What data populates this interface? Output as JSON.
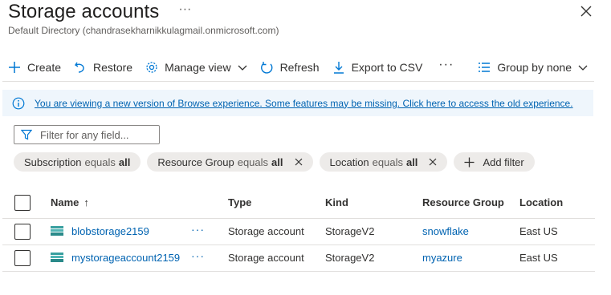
{
  "header": {
    "title": "Storage accounts",
    "more_label": "···",
    "subtitle": "Default Directory (chandrasekharnikkulagmail.onmicrosoft.com)",
    "close_icon": "close-icon"
  },
  "toolbar": {
    "create": "Create",
    "restore": "Restore",
    "manage_view": "Manage view",
    "refresh": "Refresh",
    "export_csv": "Export to CSV",
    "more": "···",
    "group_by": "Group by none"
  },
  "banner": {
    "text": "You are viewing a new version of Browse experience. Some features may be missing. Click here to access the old experience."
  },
  "filter": {
    "placeholder": "Filter for any field...",
    "value": ""
  },
  "pills": [
    {
      "field": "Subscription",
      "op": "equals",
      "value": "all",
      "removable": false
    },
    {
      "field": "Resource Group",
      "op": "equals",
      "value": "all",
      "removable": true
    },
    {
      "field": "Location",
      "op": "equals",
      "value": "all",
      "removable": true
    }
  ],
  "add_filter": "Add filter",
  "table": {
    "columns": {
      "name": "Name",
      "sort_indicator": "↑",
      "type": "Type",
      "kind": "Kind",
      "resource_group": "Resource Group",
      "location": "Location"
    },
    "rows": [
      {
        "name": "blobstorage2159",
        "more": "···",
        "type": "Storage account",
        "kind": "StorageV2",
        "resource_group": "snowflake",
        "location": "East US"
      },
      {
        "name": "mystorageaccount2159",
        "more": "···",
        "type": "Storage account",
        "kind": "StorageV2",
        "resource_group": "myazure",
        "location": "East US"
      }
    ]
  },
  "colors": {
    "accent": "#0078d4",
    "link": "#0063b1",
    "banner_bg": "#eff6fc",
    "pill_bg": "#edebe9"
  }
}
